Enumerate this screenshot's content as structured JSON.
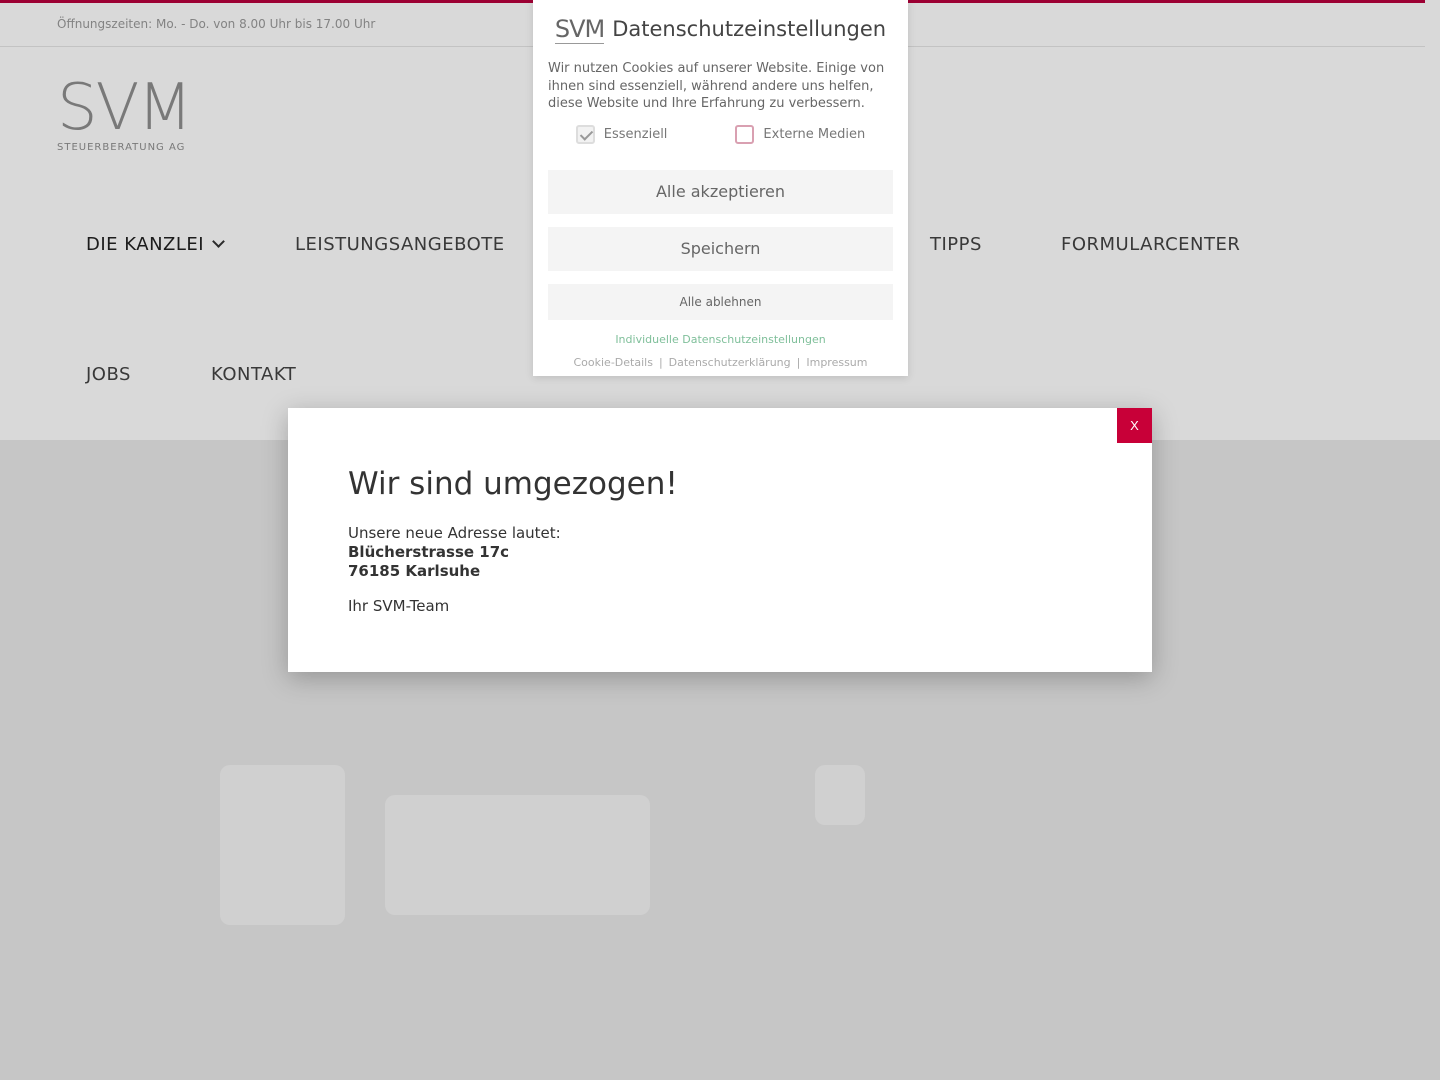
{
  "page": {
    "opening_hours": "Öffnungszeiten: Mo. - Do. von 8.00 Uhr bis 17.00 Uhr",
    "logo_text": "SVM",
    "logo_subtitle": "STEUERBERATUNG AG",
    "nav": {
      "items": [
        {
          "label": "DIE KANZLEI",
          "has_dropdown": true
        },
        {
          "label": "LEISTUNGSANGEBOTE"
        },
        {
          "label": "TIPPS"
        },
        {
          "label": "FORMULARCENTER"
        },
        {
          "label": "JOBS"
        },
        {
          "label": "KONTAKT"
        }
      ]
    },
    "accent_color": "#b8003d"
  },
  "cookie": {
    "logo": "SVM",
    "title": "Datenschutzeinstellungen",
    "text": "Wir nutzen Cookies auf unserer Website. Einige von ihnen sind essenziell, während andere uns helfen, diese Website und Ihre Erfahrung zu verbessern.",
    "options": [
      {
        "label": "Essenziell",
        "checked": true
      },
      {
        "label": "Externe Medien",
        "checked": false
      }
    ],
    "accept_all": "Alle akzeptieren",
    "save": "Speichern",
    "reject_all": "Alle ablehnen",
    "individual_link": "Individuelle Datenschutzeinstellungen",
    "footer_links": [
      "Cookie-Details",
      "Datenschutzerklärung",
      "Impressum"
    ]
  },
  "modal": {
    "close_label": "X",
    "title": "Wir sind umgezogen!",
    "intro": "Unsere neue Adresse lautet:",
    "street": "Blücherstrasse 17c",
    "city": "76185 Karlsuhe",
    "signature": "Ihr SVM-Team",
    "close_color": "#c80038"
  }
}
